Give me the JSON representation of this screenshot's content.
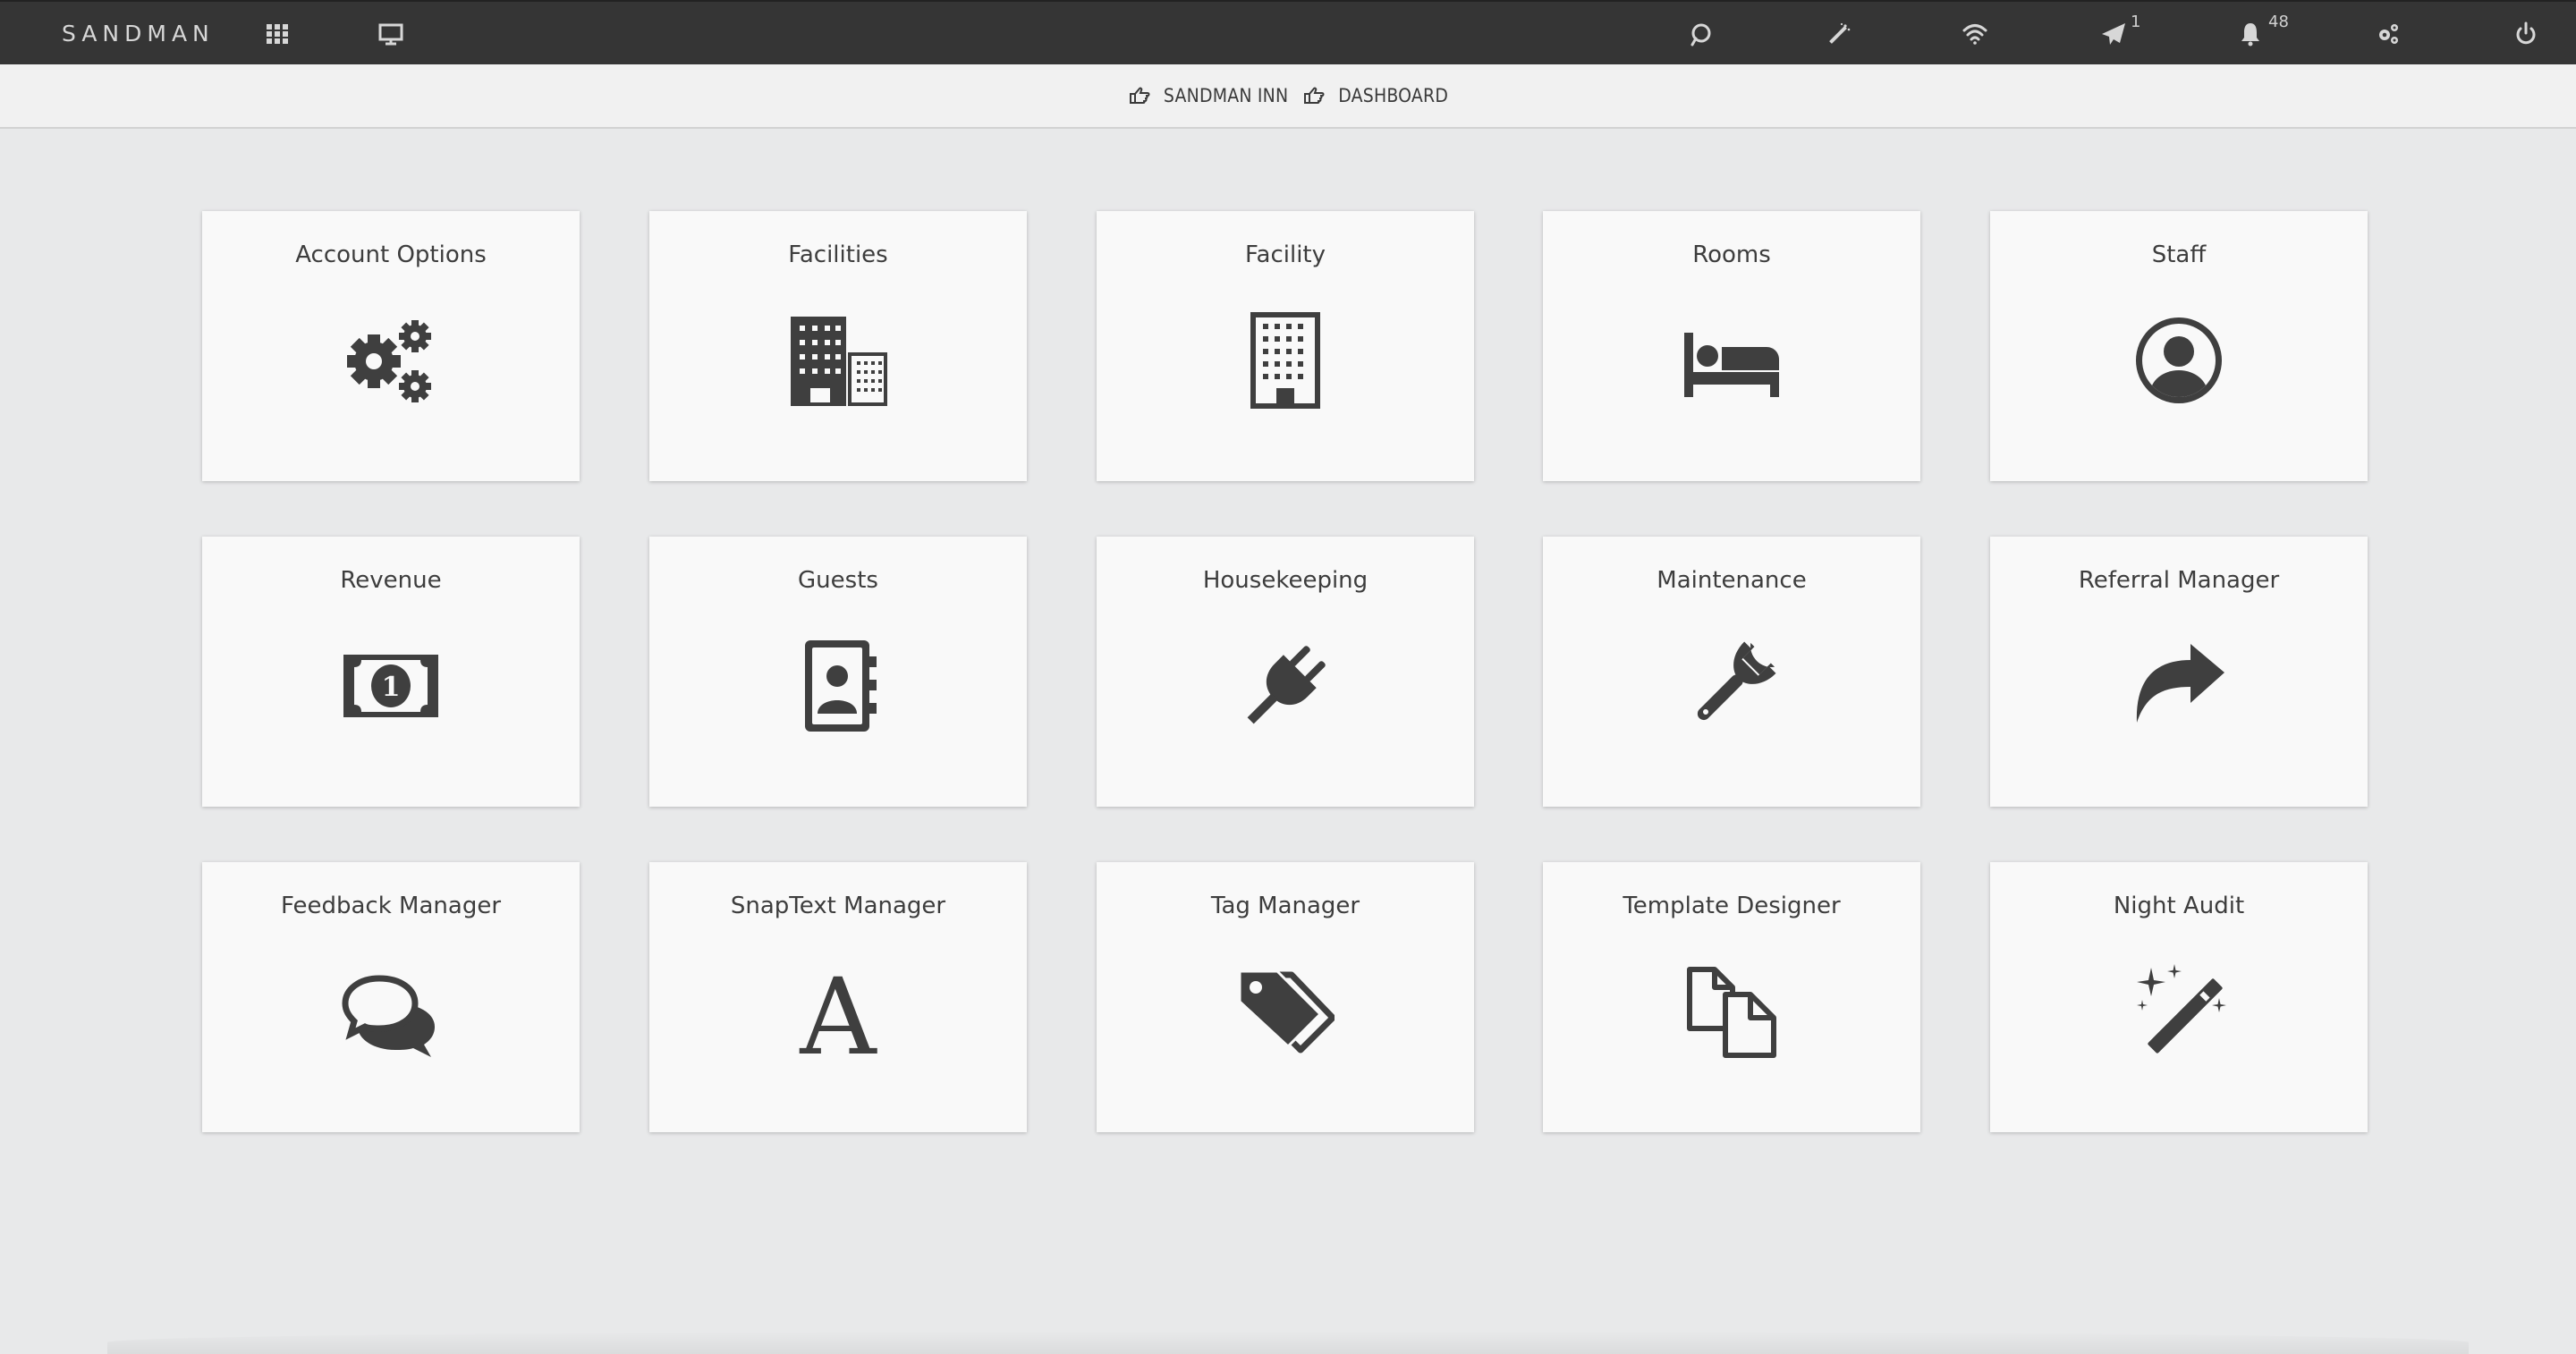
{
  "app": {
    "brand": "SANDMAN"
  },
  "topbar": {
    "messages_count": "1",
    "notifications_count": "48"
  },
  "breadcrumb": {
    "items": [
      {
        "label": "SANDMAN INN"
      },
      {
        "label": "DASHBOARD"
      }
    ]
  },
  "colors": {
    "topbar_bg": "#353535",
    "icon_dark": "#3f3f3f",
    "tile_bg": "#f9f9f9",
    "page_bg": "#e8e9ea"
  },
  "tiles": [
    {
      "label": "Account Options",
      "icon": "gears-icon"
    },
    {
      "label": "Facilities",
      "icon": "buildings-icon"
    },
    {
      "label": "Facility",
      "icon": "building-icon"
    },
    {
      "label": "Rooms",
      "icon": "bed-icon"
    },
    {
      "label": "Staff",
      "icon": "user-circle-icon"
    },
    {
      "label": "Revenue",
      "icon": "money-icon"
    },
    {
      "label": "Guests",
      "icon": "address-book-icon"
    },
    {
      "label": "Housekeeping",
      "icon": "plug-icon"
    },
    {
      "label": "Maintenance",
      "icon": "wrench-icon"
    },
    {
      "label": "Referral Manager",
      "icon": "share-arrow-icon"
    },
    {
      "label": "Feedback Manager",
      "icon": "comments-icon"
    },
    {
      "label": "SnapText Manager",
      "icon": "font-icon"
    },
    {
      "label": "Tag Manager",
      "icon": "tags-icon"
    },
    {
      "label": "Template Designer",
      "icon": "copy-files-icon"
    },
    {
      "label": "Night Audit",
      "icon": "magic-wand-icon"
    }
  ]
}
